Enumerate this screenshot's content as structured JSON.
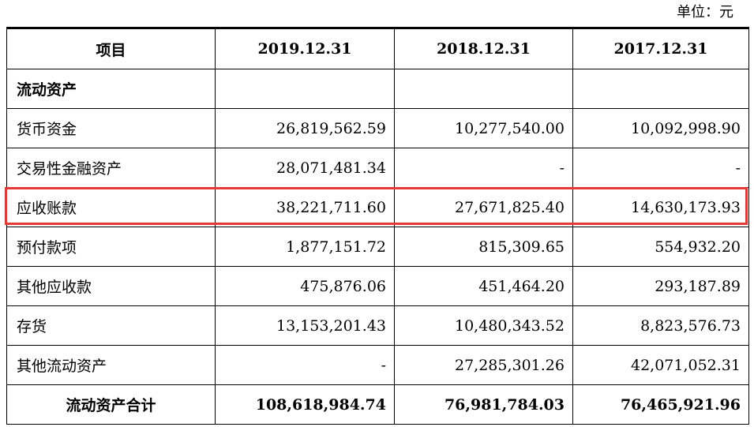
{
  "unit_label": "单位：元",
  "table": {
    "headers": [
      "项目",
      "2019.12.31",
      "2018.12.31",
      "2017.12.31"
    ],
    "section_title": "流动资产",
    "rows": [
      {
        "label": "货币资金",
        "v2019": "26,819,562.59",
        "v2018": "10,277,540.00",
        "v2017": "10,092,998.90"
      },
      {
        "label": "交易性金融资产",
        "v2019": "28,071,481.34",
        "v2018": "-",
        "v2017": "-"
      },
      {
        "label": "应收账款",
        "v2019": "38,221,711.60",
        "v2018": "27,671,825.40",
        "v2017": "14,630,173.93"
      },
      {
        "label": "预付款项",
        "v2019": "1,877,151.72",
        "v2018": "815,309.65",
        "v2017": "554,932.20"
      },
      {
        "label": "其他应收款",
        "v2019": "475,876.06",
        "v2018": "451,464.20",
        "v2017": "293,187.89"
      },
      {
        "label": "存货",
        "v2019": "13,153,201.43",
        "v2018": "10,480,343.52",
        "v2017": "8,823,576.73"
      },
      {
        "label": "其他流动资产",
        "v2019": "-",
        "v2018": "27,285,301.26",
        "v2017": "42,071,052.31"
      }
    ],
    "total": {
      "label": "流动资产合计",
      "v2019": "108,618,984.74",
      "v2018": "76,981,784.03",
      "v2017": "76,465,921.96"
    }
  },
  "highlight": {
    "row_label": "应收账款",
    "color": "#e53935"
  }
}
